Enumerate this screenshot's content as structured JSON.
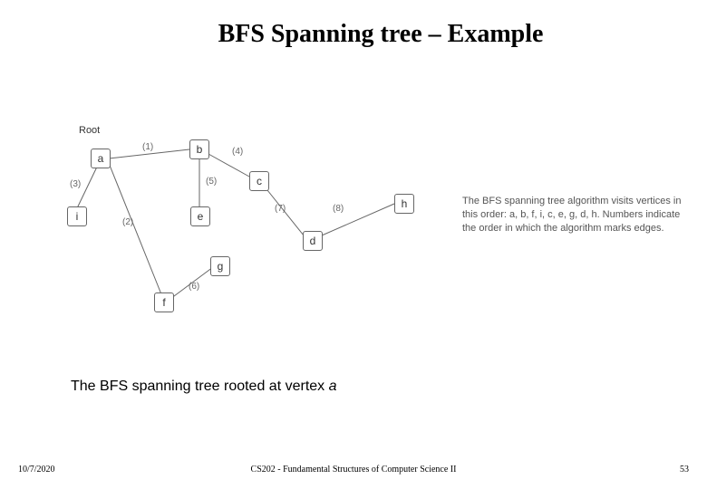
{
  "title": "BFS Spanning tree – Example",
  "root_label": "Root",
  "nodes": {
    "a": "a",
    "b": "b",
    "c": "c",
    "d": "d",
    "e": "e",
    "f": "f",
    "g": "g",
    "h": "h",
    "i": "i"
  },
  "edge_labels": {
    "e1": "(1)",
    "e2": "(2)",
    "e3": "(3)",
    "e4": "(4)",
    "e5": "(5)",
    "e6": "(6)",
    "e7": "(7)",
    "e8": "(8)"
  },
  "explain_text": "The BFS spanning tree algorithm visits vertices in this order: a, b, f, i, c, e, g, d, h. Numbers indicate the order in which the algorithm marks edges.",
  "caption_prefix": "The BFS spanning tree rooted at vertex ",
  "caption_vertex": "a",
  "footer": {
    "date": "10/7/2020",
    "course": "CS202 - Fundamental Structures of Computer Science II",
    "page": "53"
  }
}
